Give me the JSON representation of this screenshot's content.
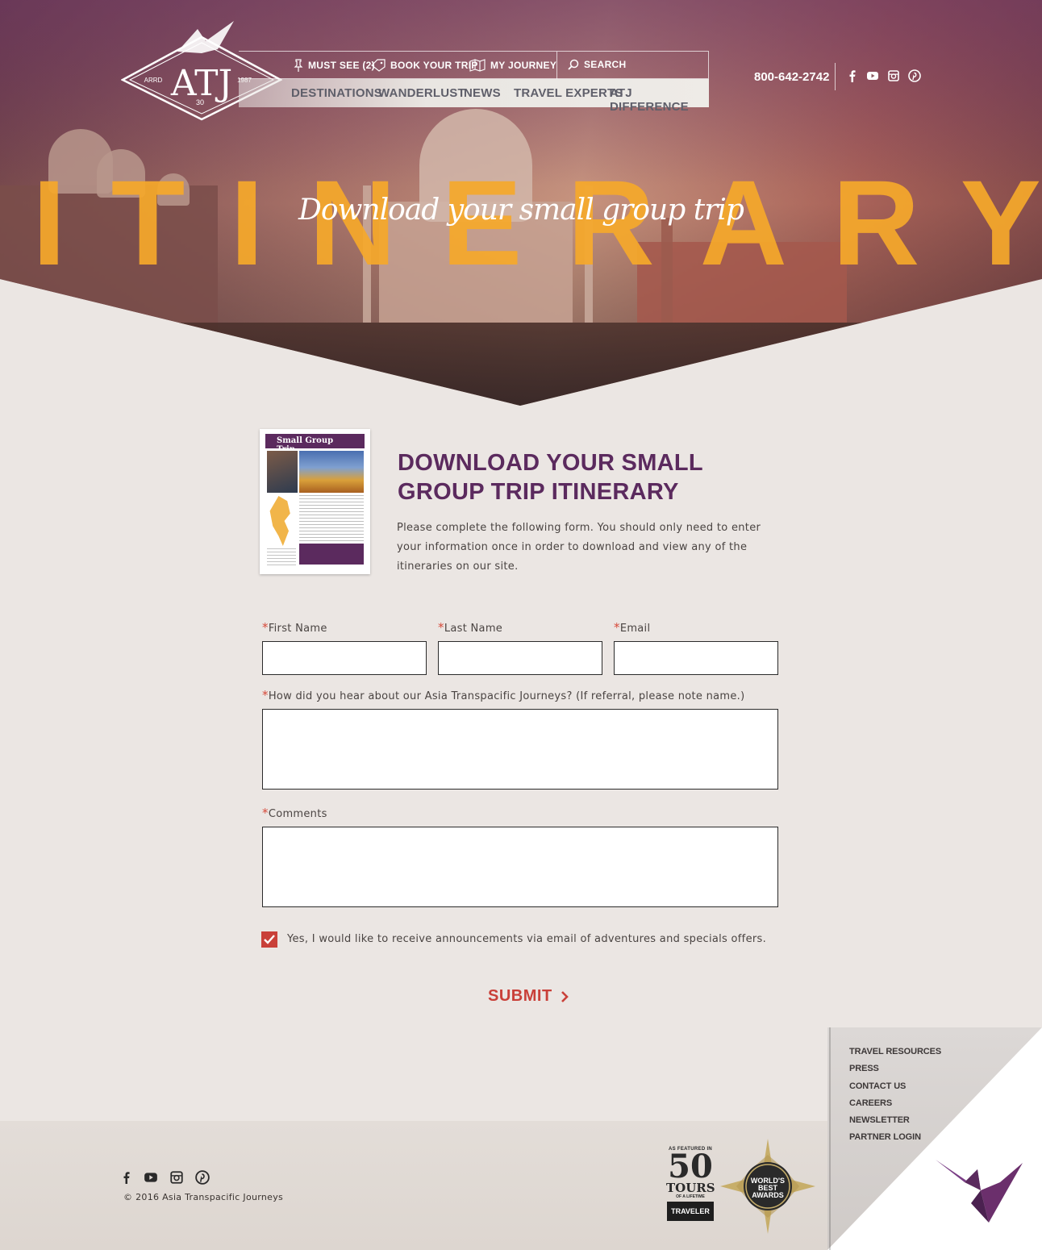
{
  "header": {
    "logo": {
      "text": "ATJ",
      "left": "ARRD",
      "right": "1987",
      "badge": "30"
    },
    "utility_nav": [
      {
        "label": "MUST SEE (2)",
        "icon": "pin-icon"
      },
      {
        "label": "BOOK YOUR TRIP",
        "icon": "tag-icon"
      },
      {
        "label": "MY JOURNEY",
        "icon": "map-icon"
      }
    ],
    "search_label": "SEARCH",
    "main_nav": [
      "DESTINATIONS",
      "WANDERLUST",
      "NEWS",
      "TRAVEL EXPERTS",
      "ATJ DIFFERENCE"
    ],
    "phone": "800-642-2742",
    "social": [
      "facebook-icon",
      "youtube-icon",
      "instagram-icon",
      "pinterest-icon"
    ]
  },
  "hero": {
    "title": "ITINERARY",
    "subtitle": "Download your small group trip"
  },
  "brochure": {
    "title": "Small Group Trip"
  },
  "content": {
    "heading_line1": "DOWNLOAD YOUR SMALL",
    "heading_line2": "GROUP TRIP ITINERARY",
    "intro": "Please complete the following form. You should only need to enter your information once in order to download and view any of the itineraries on our site."
  },
  "form": {
    "required_mark": "*",
    "first_name_label": "First Name",
    "first_name_value": "",
    "last_name_label": "Last Name",
    "last_name_value": "",
    "email_label": "Email",
    "email_value": "",
    "hear_label": "How did you hear about our Asia Transpacific Journeys? (If referral, please note name.)",
    "hear_value": "",
    "comments_label": "Comments",
    "comments_value": "",
    "optin_checked": true,
    "optin_label": "Yes, I would like to receive announcements via email of adventures and specials offers.",
    "submit_label": "SUBMIT"
  },
  "footer": {
    "copyright": "© 2016 Asia Transpacific Journeys",
    "links": [
      "TRAVEL RESOURCES",
      "PRESS",
      "CONTACT US",
      "CAREERS",
      "NEWSLETTER",
      "PARTNER LOGIN"
    ],
    "award_50": {
      "top": "AS FEATURED IN",
      "number": "50",
      "line1": "TOURS",
      "line2": "OF A LIFETIME",
      "badge": "TRAVELER"
    },
    "award_wb": {
      "line1": "WORLD'S",
      "line2": "BEST",
      "line3": "AWARDS"
    }
  },
  "colors": {
    "accent_purple": "#5b2a5e",
    "accent_red": "#c94039",
    "hero_orange": "#f6a92b"
  }
}
